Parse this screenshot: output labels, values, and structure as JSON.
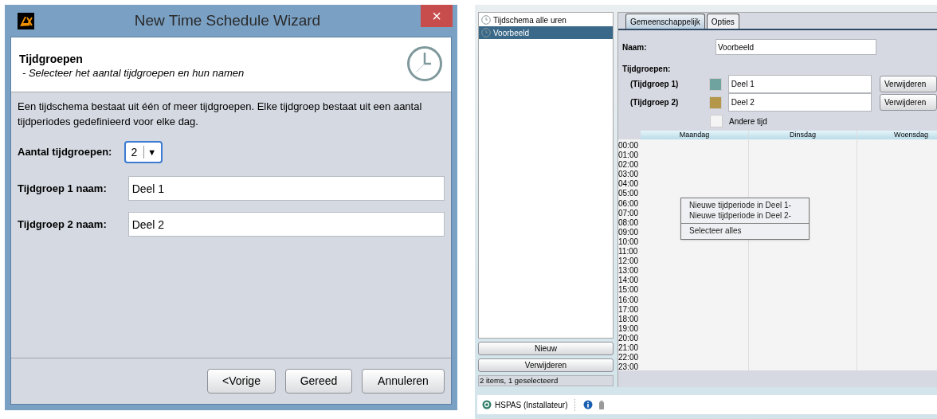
{
  "wizard": {
    "title": "New Time Schedule Wizard",
    "close": "×",
    "header": {
      "title": "Tijdgroepen",
      "subtitle": "- Selecteer het aantal tijdgroepen en hun namen"
    },
    "description": "Een tijdschema bestaat uit één of meer tijdgroepen. Elke tijdgroep bestaat uit een aantal tijdperiodes gedefinieerd voor elke dag.",
    "count_label": "Aantal tijdgroepen:",
    "count_value": "2",
    "count_arrow": "▼",
    "name_fields": [
      {
        "label": "Tijdgroep 1 naam:",
        "value": "Deel 1"
      },
      {
        "label": "Tijdgroep 2 naam:",
        "value": "Deel 2"
      }
    ],
    "buttons": [
      "<Vorige",
      "Gereed",
      "Annuleren"
    ]
  },
  "app": {
    "schedules": [
      {
        "label": "Tijdschema alle uren",
        "selected": false
      },
      {
        "label": "Voorbeeld",
        "selected": true
      }
    ],
    "list_buttons": [
      "Nieuw",
      "Verwijderen"
    ],
    "list_status": "2 items, 1 geselecteerd",
    "tabs": [
      {
        "label": "Gemeenschappelijk",
        "selected": true
      },
      {
        "label": "Opties",
        "selected": false
      }
    ],
    "name_label": "Naam:",
    "name_value": "Voorbeeld",
    "groups_label": "Tijdgroepen:",
    "groups": [
      {
        "label": "(Tijdgroep 1)",
        "color": "#6fa3a0",
        "value": "Deel 1",
        "button": "Verwijderen"
      },
      {
        "label": "(Tijdgroep 2)",
        "color": "#b5974a",
        "value": "Deel 2",
        "button": "Verwijderen"
      }
    ],
    "other_time": {
      "label": "Andere tijd",
      "color": "#f4f4f4"
    },
    "calendar": {
      "days": [
        "Maandag",
        "Dinsdag",
        "Woensdag"
      ],
      "hours": [
        "00:00",
        "01:00",
        "02:00",
        "03:00",
        "04:00",
        "05:00",
        "06:00",
        "07:00",
        "08:00",
        "09:00",
        "10:00",
        "11:00",
        "12:00",
        "13:00",
        "14:00",
        "15:00",
        "16:00",
        "17:00",
        "18:00",
        "19:00",
        "20:00",
        "21:00",
        "22:00",
        "23:00"
      ]
    },
    "context_menu": [
      [
        "Nieuwe tijdperiode in Deel 1-",
        "Nieuwe tijdperiode in Deel 2-"
      ],
      [
        "Selecteer alles"
      ]
    ],
    "status_bar": {
      "user": "HSPAS (Installateur)"
    }
  }
}
